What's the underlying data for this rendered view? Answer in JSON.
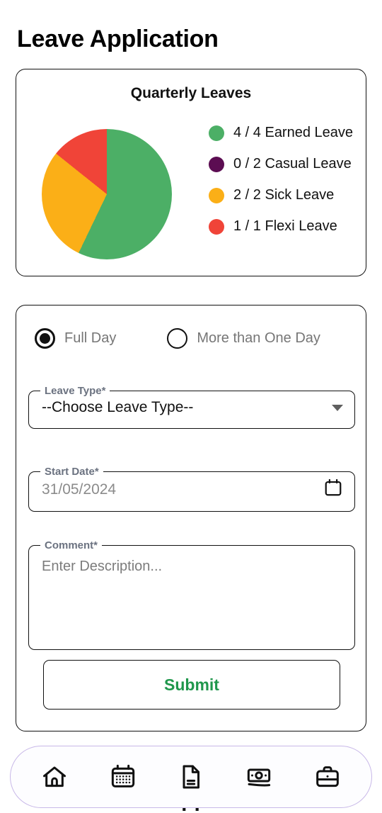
{
  "header": {
    "title": "Leave Application"
  },
  "chart_card": {
    "title": "Quarterly Leaves"
  },
  "chart_data": {
    "type": "pie",
    "title": "Quarterly Leaves",
    "legend_position": "right",
    "grid": false,
    "categories": [
      "Earned Leave",
      "Casual Leave",
      "Sick Leave",
      "Flexi Leave"
    ],
    "values": [
      4,
      0,
      2,
      1
    ],
    "totals": [
      4,
      2,
      2,
      1
    ],
    "labels": [
      "4 / 4 Earned Leave",
      "0 / 2 Casual Leave",
      "2 / 2 Sick Leave",
      "1 / 1 Flexi Leave"
    ],
    "colors": [
      "#4caf66",
      "#5c0d52",
      "#fbaf17",
      "#f04438"
    ],
    "slice_degrees": [
      205.7,
      0,
      102.9,
      51.4
    ],
    "start_angle_deg": 0,
    "direction": "clockwise"
  },
  "form": {
    "duration_options": [
      {
        "label": "Full Day",
        "selected": true
      },
      {
        "label": "More than One Day",
        "selected": false
      }
    ],
    "leave_type": {
      "label": "Leave Type*",
      "value": "--Choose Leave Type--",
      "icon": "chevron-down-icon"
    },
    "start_date": {
      "label": "Start Date*",
      "placeholder": "31/05/2024",
      "value": "",
      "icon": "calendar-icon"
    },
    "comment": {
      "label": "Comment*",
      "placeholder": "Enter Description...",
      "value": ""
    },
    "submit": {
      "label": "Submit",
      "color": "#20974c"
    }
  },
  "bottom_nav": {
    "border_color": "#c8b8e8",
    "items": [
      {
        "name": "home-icon",
        "label": "Home"
      },
      {
        "name": "calendar-icon",
        "label": "Calendar"
      },
      {
        "name": "document-icon",
        "label": "Documents"
      },
      {
        "name": "cash-icon",
        "label": "Payroll"
      },
      {
        "name": "briefcase-icon",
        "label": "Work"
      }
    ]
  },
  "background_title": {
    "text": "Leave Application"
  }
}
